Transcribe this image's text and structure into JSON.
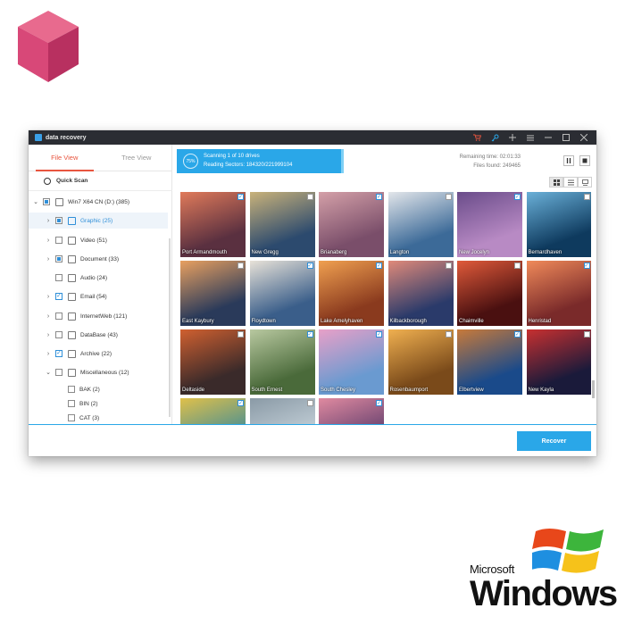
{
  "app": {
    "title": "data recovery"
  },
  "tabs": [
    {
      "label": "File  View",
      "active": true
    },
    {
      "label": "Tree  View",
      "active": false
    }
  ],
  "quick_scan": "Quick Scan",
  "tree": [
    {
      "label": "Win7 X64 CN (D:) (385)",
      "check": "partial",
      "expanded": true
    },
    {
      "label": "Graphic (25)",
      "check": "partial",
      "selected": true
    },
    {
      "label": "Video (51)",
      "check": "none"
    },
    {
      "label": "Document (33)",
      "check": "partial"
    },
    {
      "label": "Audio (24)",
      "check": "none"
    },
    {
      "label": "Email (54)",
      "check": "checked"
    },
    {
      "label": "InternetWeb (121)",
      "check": "none"
    },
    {
      "label": "DataBase (43)",
      "check": "none"
    },
    {
      "label": "Archive (22)",
      "check": "checked"
    },
    {
      "label": "Miscellaneous (12)",
      "check": "none",
      "expanded": true
    },
    {
      "label": "BAK (2)",
      "check": "none"
    },
    {
      "label": "BIN (2)",
      "check": "none"
    },
    {
      "label": "CAT (3)",
      "check": "none"
    }
  ],
  "scan": {
    "percent_label": "75%",
    "line1": "Scanning 1 of 10 drives",
    "line2": "Reading Sectors: 184320/221999104",
    "remaining": "Remaining time: 02:01:33",
    "files_found": "Files found: 249465"
  },
  "thumbnails": [
    {
      "caption": "Port Armandmouth",
      "checked": true,
      "c1": "#5a3040",
      "c2": "#e07a5a"
    },
    {
      "caption": "New Gregg",
      "checked": false,
      "c1": "#2c4a6e",
      "c2": "#c9b27a"
    },
    {
      "caption": "Brianaberg",
      "checked": true,
      "c1": "#7a4e6a",
      "c2": "#d4a0a8"
    },
    {
      "caption": "Langton",
      "checked": false,
      "c1": "#3c6a98",
      "c2": "#e3e6ea"
    },
    {
      "caption": "New Jocelyn",
      "checked": true,
      "c1": "#b88ac4",
      "c2": "#6a4c8a"
    },
    {
      "caption": "Bernardhaven",
      "checked": false,
      "c1": "#0e3a5e",
      "c2": "#6ab0d8"
    },
    {
      "caption": "East Kaybury",
      "checked": false,
      "c1": "#2a3a5a",
      "c2": "#e8a060"
    },
    {
      "caption": "Floydtown",
      "checked": true,
      "c1": "#3a5e8a",
      "c2": "#e8e2d8"
    },
    {
      "caption": "Lake Amelyhaven",
      "checked": true,
      "c1": "#8a3a1e",
      "c2": "#f0a050"
    },
    {
      "caption": "Kilbackborough",
      "checked": false,
      "c1": "#2a3a6a",
      "c2": "#e08a7a"
    },
    {
      "caption": "Chaimville",
      "checked": false,
      "c1": "#4a1010",
      "c2": "#e05a3a"
    },
    {
      "caption": "Henristad",
      "checked": true,
      "c1": "#7a2a2a",
      "c2": "#f08a5a"
    },
    {
      "caption": "Deltaside",
      "checked": false,
      "c1": "#3a2a2a",
      "c2": "#d06030"
    },
    {
      "caption": "South Ernest",
      "checked": true,
      "c1": "#4a6a3a",
      "c2": "#b8c8a0"
    },
    {
      "caption": "South Chesley",
      "checked": true,
      "c1": "#6a9ad0",
      "c2": "#e8a0c8"
    },
    {
      "caption": "Rosenbaumport",
      "checked": false,
      "c1": "#7a4a1a",
      "c2": "#f0b050"
    },
    {
      "caption": "Elbertview",
      "checked": true,
      "c1": "#1a4a8a",
      "c2": "#c87a3a"
    },
    {
      "caption": "New Kayla",
      "checked": false,
      "c1": "#1a1a3a",
      "c2": "#c83030"
    },
    {
      "caption": "",
      "checked": true,
      "c1": "#3a8a9a",
      "c2": "#e0c04a"
    },
    {
      "caption": "",
      "checked": false,
      "c1": "#c8d4dc",
      "c2": "#8a9aa6"
    },
    {
      "caption": "",
      "checked": true,
      "c1": "#5a3a6a",
      "c2": "#e08aa0"
    }
  ],
  "recover_label": "Recover",
  "windows_logo": {
    "brand": "Microsoft",
    "product": "Windows"
  },
  "colors": {
    "accent": "#2aa7e8",
    "tab_active": "#e8553f",
    "cube": "#d84878"
  }
}
